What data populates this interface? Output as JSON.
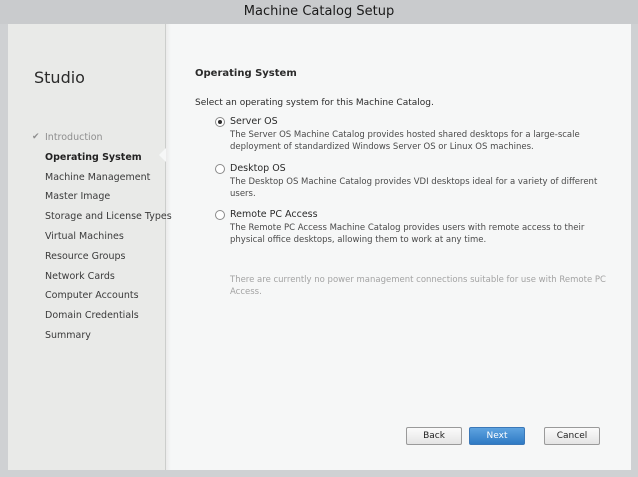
{
  "window": {
    "title": "Machine Catalog Setup"
  },
  "sidebar": {
    "heading": "Studio",
    "items": [
      {
        "label": "Introduction",
        "state": "done"
      },
      {
        "label": "Operating System",
        "state": "active"
      },
      {
        "label": "Machine Management",
        "state": "pending"
      },
      {
        "label": "Master Image",
        "state": "pending"
      },
      {
        "label": "Storage and License Types",
        "state": "pending"
      },
      {
        "label": "Virtual Machines",
        "state": "pending"
      },
      {
        "label": "Resource Groups",
        "state": "pending"
      },
      {
        "label": "Network Cards",
        "state": "pending"
      },
      {
        "label": "Computer Accounts",
        "state": "pending"
      },
      {
        "label": "Domain Credentials",
        "state": "pending"
      },
      {
        "label": "Summary",
        "state": "pending"
      }
    ],
    "completed_icon": "check-icon"
  },
  "main": {
    "title": "Operating System",
    "prompt": "Select an operating system for this Machine Catalog.",
    "options": [
      {
        "label": "Server OS",
        "selected": true,
        "description": "The Server OS Machine Catalog provides hosted shared desktops for a large-scale deployment of standardized Windows Server OS or Linux OS machines."
      },
      {
        "label": "Desktop OS",
        "selected": false,
        "description": "The Desktop OS Machine Catalog provides VDI desktops ideal for a variety of different users."
      },
      {
        "label": "Remote PC Access",
        "selected": false,
        "description": "The Remote PC Access Machine Catalog provides users with remote access to their physical office desktops, allowing them to work at any time."
      }
    ],
    "note": "There are currently no power management connections suitable for use with Remote PC Access."
  },
  "footer": {
    "back_label": "Back",
    "next_label": "Next",
    "cancel_label": "Cancel"
  },
  "colors": {
    "accent": "#2f7ac4",
    "sidebar_bg": "#e9eae8",
    "content_bg": "#f6f7f7",
    "muted_text": "#a3a3a3"
  }
}
